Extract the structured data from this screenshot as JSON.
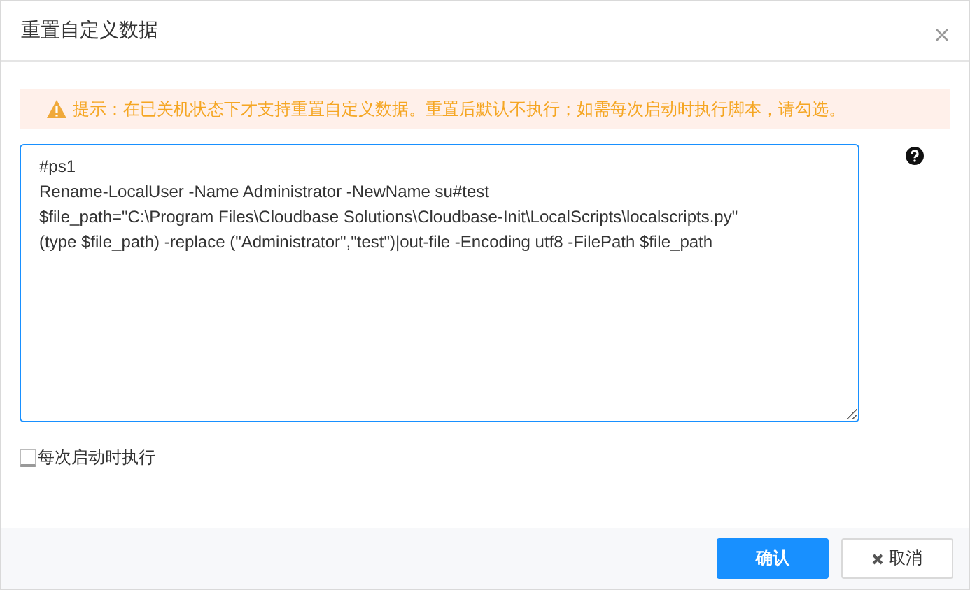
{
  "dialog": {
    "title": "重置自定义数据"
  },
  "alert": {
    "text": "提示：在已关机状态下才支持重置自定义数据。重置后默认不执行；如需每次启动时执行脚本，请勾选。"
  },
  "script_field": {
    "value": "#ps1\nRename-LocalUser -Name Administrator -NewName su#test\n$file_path=\"C:\\Program Files\\Cloudbase Solutions\\Cloudbase-Init\\LocalScripts\\localscripts.py\"\n(type $file_path) -replace (\"Administrator\",\"test\")|out-file -Encoding utf8 -FilePath $file_path"
  },
  "run_every_boot": {
    "label": "每次启动时执行",
    "checked": false
  },
  "buttons": [
    {
      "label": "确认",
      "kind": "primary"
    },
    {
      "label": "取消",
      "kind": "cancel"
    }
  ]
}
